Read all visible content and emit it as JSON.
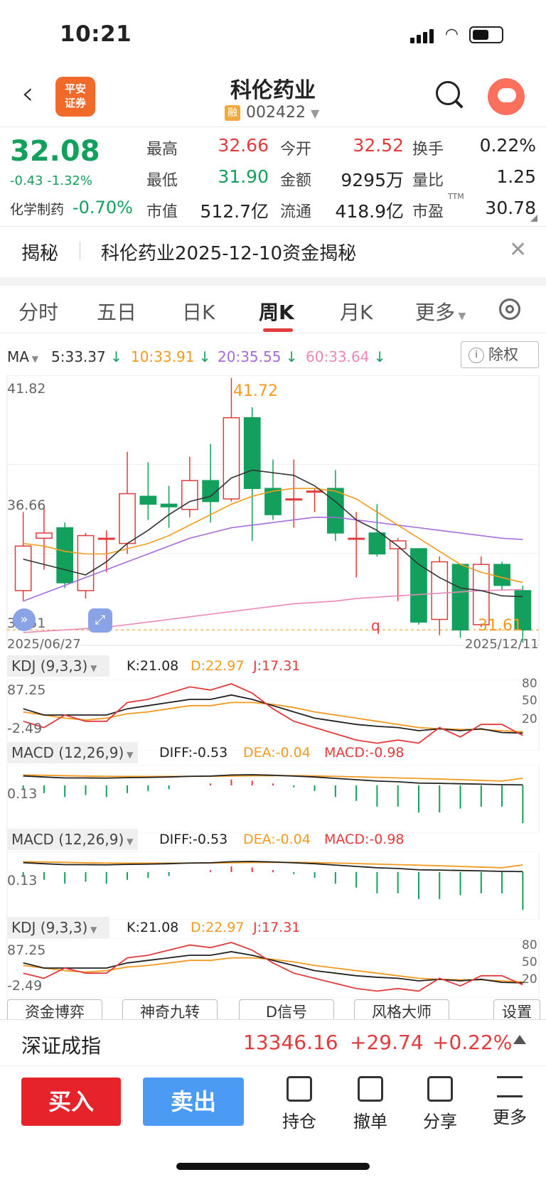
{
  "status_bar": {
    "time": "10:21"
  },
  "header": {
    "logo_line1": "平安",
    "logo_line2": "证券",
    "stock_name": "科伦药业",
    "rong_badge": "融",
    "stock_code": "002422"
  },
  "quote": {
    "price": "32.08",
    "change": "-0.43 -1.32%",
    "sector": "化学制药",
    "sector_change": "-0.70%",
    "cells": [
      {
        "label": "最高",
        "value": "32.66"
      },
      {
        "label": "今开",
        "value": "32.52"
      },
      {
        "label": "换手",
        "value": "0.22%"
      },
      {
        "label": "最低",
        "value": "31.90"
      },
      {
        "label": "金额",
        "value": "9295万"
      },
      {
        "label": "量比",
        "value": "1.25"
      },
      {
        "label": "市值",
        "value": "512.7亿"
      },
      {
        "label": "流通",
        "value": "418.9亿"
      },
      {
        "label": "市盈",
        "value": "30.78"
      }
    ],
    "pe_sup": "TTM"
  },
  "reveal": {
    "label": "揭秘",
    "text": "科伦药业2025-12-10资金揭秘"
  },
  "tabs": [
    "分时",
    "五日",
    "日K",
    "周K",
    "月K",
    "更多"
  ],
  "active_tab": "周K",
  "ma": {
    "label": "MA",
    "ma5": "5:33.37",
    "ma10": "10:33.91",
    "ma20": "20:35.55",
    "ma60": "60:33.64",
    "fuquan": "除权"
  },
  "kline_axis": {
    "y_top": "41.82",
    "y_mid": "36.66",
    "y_bottom": "31.51",
    "date_start": "2025/06/27",
    "date_end": "2025/12/11",
    "max_mark": "41.72",
    "min_mark": "31.61",
    "q_mark": "q"
  },
  "kdj_panel": {
    "name": "KDJ (9,3,3)",
    "k": "K:21.08",
    "d": "D:22.97",
    "j": "J:17.31",
    "y_top": "87.25",
    "y_bottom": "-2.49",
    "levels": [
      "80",
      "50",
      "20"
    ]
  },
  "macd_panel": {
    "name": "MACD (12,26,9)",
    "diff": "DIFF:-0.53",
    "dea": "DEA:-0.04",
    "macd": "MACD:-0.98",
    "y_label": "0.13"
  },
  "indicator_buttons": [
    "资金博弈",
    "神奇九转",
    "D信号",
    "风格大师",
    "设置"
  ],
  "index_bar": {
    "name": "深证成指",
    "value": "13346.16",
    "change": "+29.74",
    "percent": "+0.22%"
  },
  "actions": {
    "buy": "买入",
    "sell": "卖出",
    "tools": [
      "持仓",
      "撤单",
      "分享",
      "更多"
    ]
  },
  "colors": {
    "up": "#e23b3b",
    "down": "#12a05c",
    "ma5": "#333333",
    "ma10": "#f39a1e",
    "ma20": "#a56bdc",
    "ma60": "#ef86b8"
  },
  "chart_data": {
    "type": "candlestick",
    "period": "weekly",
    "ylim": [
      31.51,
      41.82
    ],
    "candles": [
      {
        "o": 33.6,
        "c": 35.3,
        "h": 36.6,
        "l": 33.2
      },
      {
        "o": 35.6,
        "c": 35.8,
        "h": 36.8,
        "l": 34.4
      },
      {
        "o": 36.0,
        "c": 33.9,
        "h": 36.2,
        "l": 33.7
      },
      {
        "o": 33.6,
        "c": 35.7,
        "h": 35.8,
        "l": 33.3
      },
      {
        "o": 35.6,
        "c": 35.6,
        "h": 35.9,
        "l": 34.3
      },
      {
        "o": 35.4,
        "c": 37.3,
        "h": 38.9,
        "l": 35.0
      },
      {
        "o": 37.2,
        "c": 36.9,
        "h": 38.5,
        "l": 36.3
      },
      {
        "o": 36.9,
        "c": 36.8,
        "h": 37.6,
        "l": 36.0
      },
      {
        "o": 36.7,
        "c": 37.8,
        "h": 38.7,
        "l": 36.4
      },
      {
        "o": 37.8,
        "c": 37.0,
        "h": 39.2,
        "l": 36.2
      },
      {
        "o": 37.1,
        "c": 40.2,
        "h": 41.72,
        "l": 37.0
      },
      {
        "o": 40.2,
        "c": 37.5,
        "h": 40.6,
        "l": 35.5
      },
      {
        "o": 37.5,
        "c": 36.5,
        "h": 38.6,
        "l": 36.3
      },
      {
        "o": 37.1,
        "c": 37.1,
        "h": 38.6,
        "l": 36.0
      },
      {
        "o": 37.4,
        "c": 37.4,
        "h": 37.5,
        "l": 36.6
      },
      {
        "o": 37.5,
        "c": 35.8,
        "h": 38.2,
        "l": 35.5
      },
      {
        "o": 35.6,
        "c": 35.6,
        "h": 36.6,
        "l": 34.1
      },
      {
        "o": 35.8,
        "c": 35.0,
        "h": 36.9,
        "l": 34.9
      },
      {
        "o": 35.2,
        "c": 35.5,
        "h": 35.6,
        "l": 33.2
      },
      {
        "o": 35.2,
        "c": 32.4,
        "h": 35.2,
        "l": 32.3
      },
      {
        "o": 32.5,
        "c": 34.7,
        "h": 34.9,
        "l": 31.9
      },
      {
        "o": 34.6,
        "c": 32.1,
        "h": 34.6,
        "l": 31.8
      },
      {
        "o": 32.3,
        "c": 34.6,
        "h": 34.9,
        "l": 32.2
      },
      {
        "o": 34.6,
        "c": 33.8,
        "h": 34.7,
        "l": 33.6
      },
      {
        "o": 33.6,
        "c": 32.1,
        "h": 33.8,
        "l": 31.61
      }
    ],
    "ma5": [
      34.8,
      34.6,
      34.4,
      34.2,
      34.7,
      35.4,
      35.9,
      36.5,
      37.0,
      37.2,
      37.9,
      38.2,
      38.1,
      38.0,
      37.6,
      37.0,
      36.3,
      35.9,
      35.3,
      34.6,
      34.1,
      33.7,
      33.6,
      33.4,
      33.37
    ],
    "ma10": [
      35.4,
      35.3,
      35.1,
      35.0,
      35.0,
      35.2,
      35.4,
      35.7,
      36.1,
      36.5,
      36.9,
      37.2,
      37.4,
      37.5,
      37.5,
      37.4,
      37.1,
      36.6,
      36.1,
      35.6,
      35.1,
      34.6,
      34.3,
      34.1,
      33.91
    ],
    "ma20": [
      33.2,
      33.5,
      33.8,
      34.1,
      34.4,
      34.7,
      35.0,
      35.3,
      35.6,
      35.8,
      36.0,
      36.1,
      36.2,
      36.3,
      36.4,
      36.4,
      36.3,
      36.2,
      36.1,
      36.0,
      35.9,
      35.8,
      35.7,
      35.6,
      35.55
    ],
    "ma60": [
      32.0,
      32.05,
      32.1,
      32.15,
      32.2,
      32.3,
      32.4,
      32.5,
      32.6,
      32.7,
      32.8,
      32.9,
      33.0,
      33.1,
      33.15,
      33.2,
      33.3,
      33.35,
      33.4,
      33.45,
      33.5,
      33.55,
      33.6,
      33.62,
      33.64
    ],
    "kdj": {
      "k": [
        60,
        50,
        50,
        50,
        50,
        60,
        65,
        70,
        75,
        75,
        82,
        75,
        65,
        55,
        45,
        40,
        35,
        32,
        30,
        25,
        28,
        25,
        28,
        22,
        21.08
      ],
      "d": [
        55,
        50,
        45,
        42,
        45,
        52,
        55,
        60,
        65,
        65,
        70,
        70,
        67,
        62,
        55,
        50,
        45,
        40,
        35,
        30,
        28,
        27,
        27,
        25,
        22.97
      ],
      "j": [
        40,
        30,
        50,
        40,
        40,
        70,
        75,
        85,
        95,
        90,
        100,
        85,
        60,
        40,
        30,
        20,
        10,
        5,
        10,
        5,
        30,
        15,
        35,
        35,
        17.31
      ]
    },
    "macd": {
      "diff": [
        0.13,
        0.05,
        -0.02,
        -0.02,
        -0.03,
        0.0,
        0.02,
        0.05,
        0.1,
        0.12,
        0.2,
        0.22,
        0.18,
        0.12,
        0.05,
        -0.05,
        -0.15,
        -0.25,
        -0.3,
        -0.4,
        -0.42,
        -0.45,
        -0.48,
        -0.52,
        -0.53
      ],
      "dea": [
        0.2,
        0.18,
        0.15,
        0.12,
        0.1,
        0.09,
        0.09,
        0.09,
        0.1,
        0.1,
        0.12,
        0.14,
        0.15,
        0.15,
        0.13,
        0.1,
        0.06,
        0.02,
        -0.02,
        -0.06,
        -0.1,
        -0.15,
        -0.2,
        -0.25,
        -0.04
      ],
      "hist": [
        -0.1,
        -0.2,
        -0.3,
        -0.25,
        -0.3,
        -0.2,
        -0.15,
        -0.1,
        0.0,
        0.05,
        0.15,
        0.12,
        0.05,
        -0.05,
        -0.15,
        -0.3,
        -0.4,
        -0.55,
        -0.55,
        -0.7,
        -0.7,
        -0.6,
        -0.55,
        -0.55,
        -0.98
      ]
    }
  }
}
